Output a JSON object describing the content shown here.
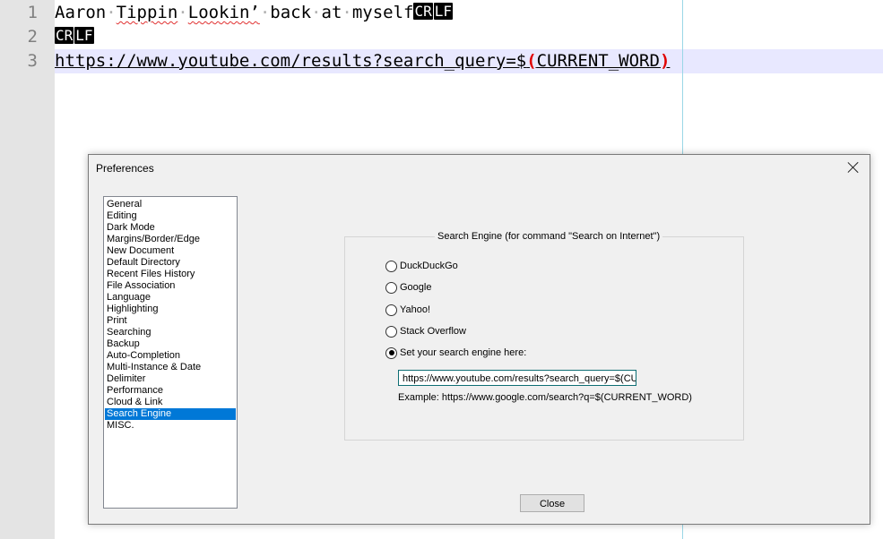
{
  "editor": {
    "line_numbers": [
      "1",
      "2",
      "3"
    ],
    "line1": {
      "w1": "Aaron",
      "w2": "Tippin",
      "w3": "Lookin’",
      "w4": "back",
      "w5": "at",
      "w6": "myself",
      "space_marker": "·",
      "eol_cr": "CR",
      "eol_lf": "LF"
    },
    "line2": {
      "eol_cr": "CR",
      "eol_lf": "LF"
    },
    "line3": {
      "url": "https://www.youtube.com/results?search_query=$",
      "open_paren": "(",
      "word": "CURRENT_WORD",
      "close_paren": ")"
    }
  },
  "dialog": {
    "title": "Preferences",
    "categories": [
      "General",
      "Editing",
      "Dark Mode",
      "Margins/Border/Edge",
      "New Document",
      "Default Directory",
      "Recent Files History",
      "File Association",
      "Language",
      "Highlighting",
      "Print",
      "Searching",
      "Backup",
      "Auto-Completion",
      "Multi-Instance & Date",
      "Delimiter",
      "Performance",
      "Cloud & Link",
      "Search Engine",
      "MISC."
    ],
    "selected_category": "Search Engine",
    "group_title": "Search Engine (for command \"Search on Internet\")",
    "options": {
      "duckduckgo": "DuckDuckGo",
      "google": "Google",
      "yahoo": "Yahoo!",
      "stackoverflow": "Stack Overflow",
      "custom": "Set your search engine here:"
    },
    "selected_option": "custom",
    "custom_url_value": "https://www.youtube.com/results?search_query=$(CURRENT_WORD)",
    "example": "Example: https://www.google.com/search?q=$(CURRENT_WORD)",
    "close_label": "Close"
  },
  "colors": {
    "selection": "#0078d7",
    "current_line": "#e8e8ff",
    "paren_highlight": "#e00000",
    "edge_line": "#9ad7e6"
  }
}
